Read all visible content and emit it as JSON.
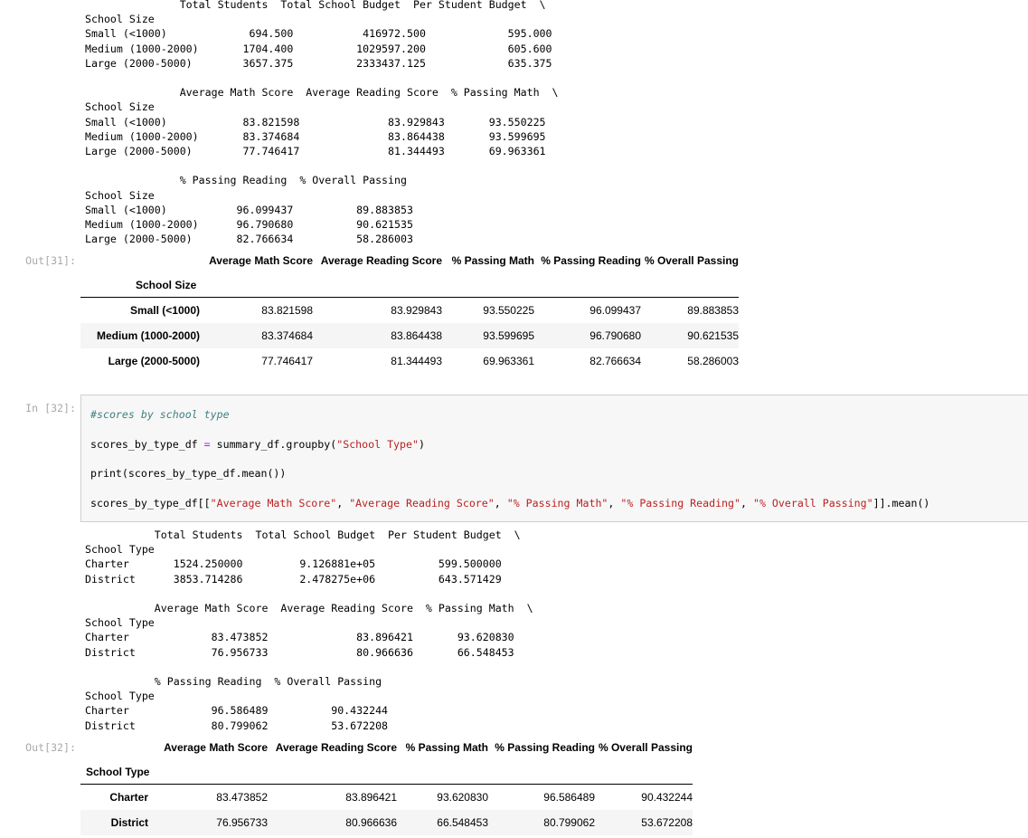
{
  "out31": {
    "prompt": "Out[31]:",
    "printed_text": "               Total Students  Total School Budget  Per Student Budget  \\\nSchool Size\nSmall (<1000)             694.500           416972.500             595.000\nMedium (1000-2000)       1704.400          1029597.200             605.600\nLarge (2000-5000)        3657.375          2333437.125             635.375\n\n               Average Math Score  Average Reading Score  % Passing Math  \\\nSchool Size\nSmall (<1000)            83.821598              83.929843       93.550225\nMedium (1000-2000)       83.374684              83.864438       93.599695\nLarge (2000-5000)        77.746417              81.344493       69.963361\n\n               % Passing Reading  % Overall Passing\nSchool Size\nSmall (<1000)           96.099437          89.883853\nMedium (1000-2000)      96.790680          90.621535\nLarge (2000-5000)       82.766634          58.286003",
    "table": {
      "columns": [
        "Average Math Score",
        "Average Reading Score",
        "% Passing Math",
        "% Passing Reading",
        "% Overall Passing"
      ],
      "index_name": "School Size",
      "rows": [
        {
          "index": "Small (<1000)",
          "values": [
            "83.821598",
            "83.929843",
            "93.550225",
            "96.099437",
            "89.883853"
          ]
        },
        {
          "index": "Medium (1000-2000)",
          "values": [
            "83.374684",
            "83.864438",
            "93.599695",
            "96.790680",
            "90.621535"
          ]
        },
        {
          "index": "Large (2000-5000)",
          "values": [
            "77.746417",
            "81.344493",
            "69.963361",
            "82.766634",
            "58.286003"
          ]
        }
      ]
    }
  },
  "in32": {
    "prompt": "In [32]:",
    "comment": "#scores by school type",
    "line2_var": "scores_by_type_df ",
    "line2_op": "=",
    "line2_call": " summary_df.groupby(",
    "line2_str": "\"School Type\"",
    "line2_end": ")",
    "line3": "print(scores_by_type_df.mean())",
    "line4_start": "scores_by_type_df[[",
    "line4_s1": "\"Average Math Score\"",
    "line4_s2": "\"Average Reading Score\"",
    "line4_s3": "\"% Passing Math\"",
    "line4_s4": "\"% Passing Reading\"",
    "line4_s5": "\"% Overall Passing\"",
    "line4_sep": ", ",
    "line4_end": "]].mean()"
  },
  "out32": {
    "prompt": "Out[32]:",
    "printed_text": "           Total Students  Total School Budget  Per Student Budget  \\\nSchool Type\nCharter       1524.250000         9.126881e+05          599.500000\nDistrict      3853.714286         2.478275e+06          643.571429\n\n           Average Math Score  Average Reading Score  % Passing Math  \\\nSchool Type\nCharter             83.473852              83.896421       93.620830\nDistrict            76.956733              80.966636       66.548453\n\n           % Passing Reading  % Overall Passing\nSchool Type\nCharter             96.586489          90.432244\nDistrict            80.799062          53.672208",
    "table": {
      "columns": [
        "Average Math Score",
        "Average Reading Score",
        "% Passing Math",
        "% Passing Reading",
        "% Overall Passing"
      ],
      "index_name": "School Type",
      "rows": [
        {
          "index": "Charter",
          "values": [
            "83.473852",
            "83.896421",
            "93.620830",
            "96.586489",
            "90.432244"
          ]
        },
        {
          "index": "District",
          "values": [
            "76.956733",
            "80.966636",
            "66.548453",
            "80.799062",
            "53.672208"
          ]
        }
      ]
    }
  }
}
